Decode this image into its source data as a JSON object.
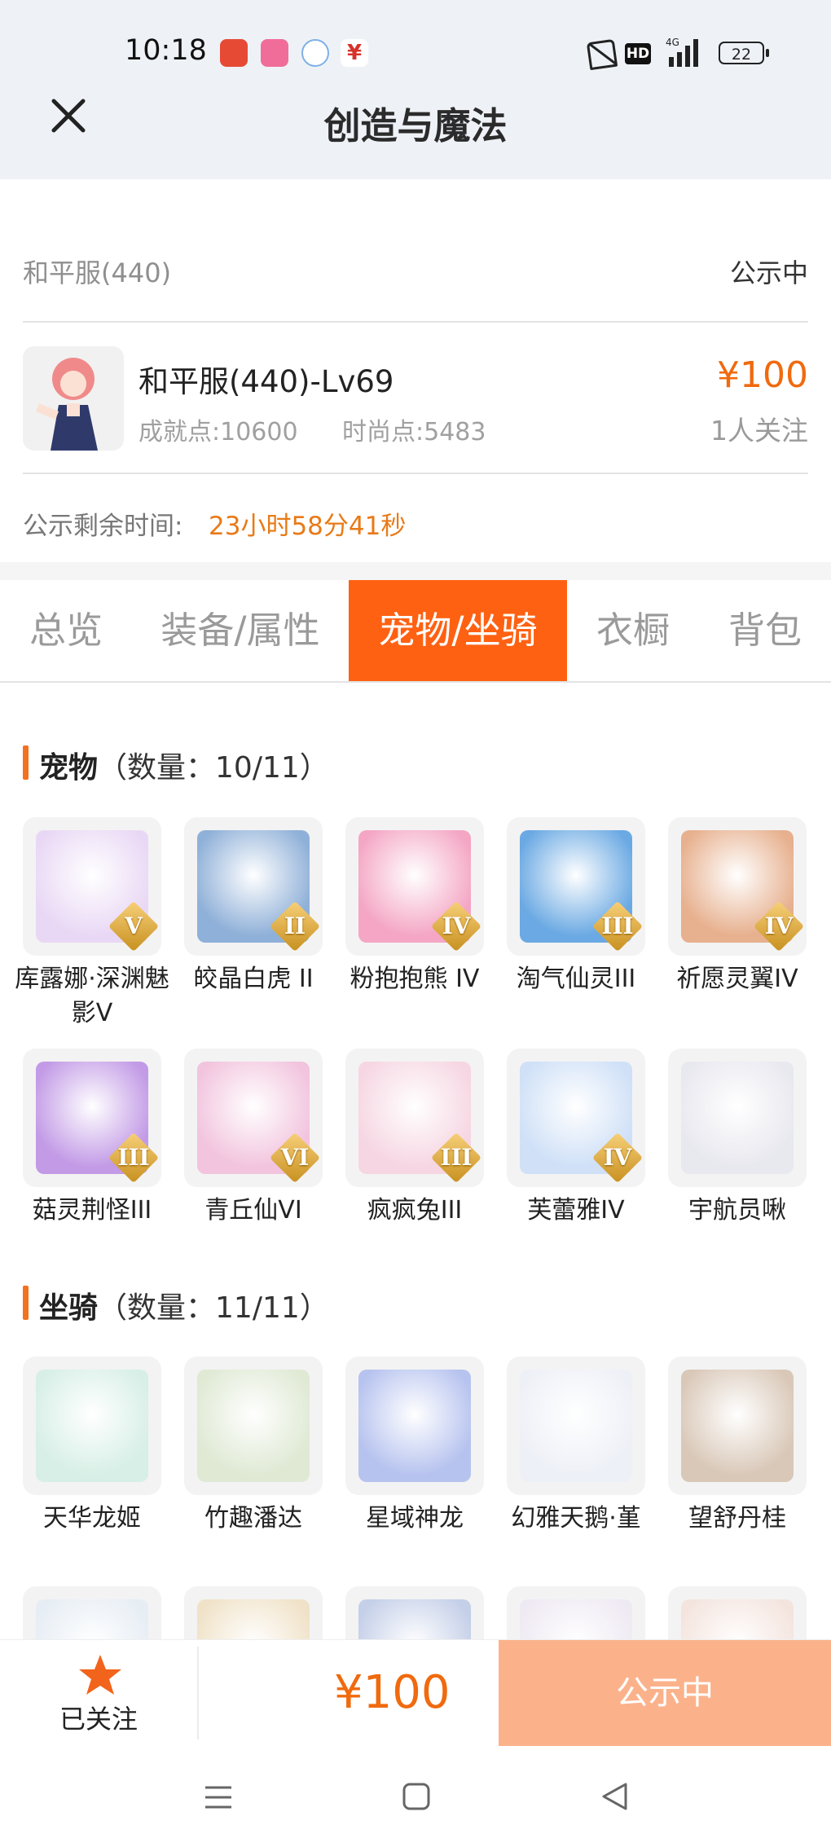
{
  "status_bar": {
    "time": "10:18",
    "hd": "HD",
    "network": "4G",
    "battery": "22"
  },
  "header": {
    "title": "创造与魔法"
  },
  "listing": {
    "server": "和平服(440)",
    "status": "公示中",
    "character_name": "和平服(440)-Lv69",
    "achievement": "成就点:10600",
    "fashion": "时尚点:5483",
    "price": "¥100",
    "followers": "1人关注",
    "remaining_label": "公示剩余时间:",
    "remaining_value": "23小时58分41秒"
  },
  "tabs": [
    {
      "label": "总览"
    },
    {
      "label": "装备/属性"
    },
    {
      "label": "宠物/坐骑",
      "active": true
    },
    {
      "label": "衣橱"
    },
    {
      "label": "背包"
    }
  ],
  "pets": {
    "heading": "宠物",
    "count": "（数量：10/11）",
    "items": [
      {
        "name": "库露娜·深渊魅影V",
        "rank": "V",
        "color": "#e9d8f5"
      },
      {
        "name": "皎晶白虎 II",
        "rank": "II",
        "color": "#8fb0d8"
      },
      {
        "name": "粉抱抱熊 IV",
        "rank": "IV",
        "color": "#f4a6c4"
      },
      {
        "name": "淘气仙灵III",
        "rank": "III",
        "color": "#6aa9e3"
      },
      {
        "name": "祈愿灵翼IV",
        "rank": "IV",
        "color": "#e7b08e"
      },
      {
        "name": "菇灵荆怪III",
        "rank": "III",
        "color": "#c29ae6"
      },
      {
        "name": "青丘仙VI",
        "rank": "VI",
        "color": "#f2c4de"
      },
      {
        "name": "疯疯兔III",
        "rank": "III",
        "color": "#f6d6e2"
      },
      {
        "name": "芙蕾雅IV",
        "rank": "IV",
        "color": "#cfe0f7"
      },
      {
        "name": "宇航员啾",
        "rank": "",
        "color": "#e8e8ef"
      }
    ]
  },
  "mounts": {
    "heading": "坐骑",
    "count": "（数量：11/11）",
    "items": [
      {
        "name": "天华龙姬",
        "color": "#d7efe6"
      },
      {
        "name": "竹趣潘达",
        "color": "#dfe9d4"
      },
      {
        "name": "星域神龙",
        "color": "#b7c3ef"
      },
      {
        "name": "幻雅天鹅·堇",
        "color": "#eef0f7"
      },
      {
        "name": "望舒丹桂",
        "color": "#d9c8b8"
      }
    ],
    "partial_row_colors": [
      "#e6edf4",
      "#f0e2c8",
      "#c4cfe8",
      "#efe9f3",
      "#f4e4de"
    ]
  },
  "bottom_bar": {
    "follow_label": "已关注",
    "price": "¥100",
    "action": "公示中"
  },
  "colors": {
    "accent": "#ff6112",
    "price": "#f06a0e",
    "action_button": "#fbb28b"
  }
}
